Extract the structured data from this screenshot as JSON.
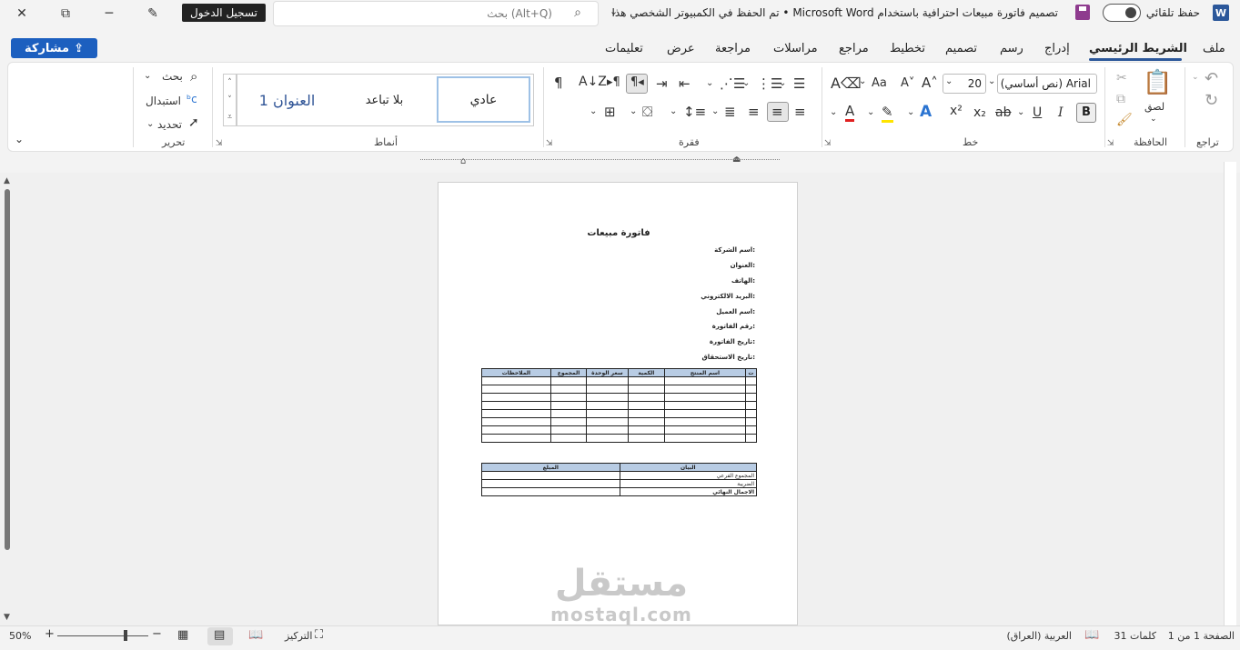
{
  "titlebar": {
    "close": "✕",
    "restore": "⧉",
    "minimize": "─",
    "pen": "✎",
    "signin": "تسجيل الدخول",
    "search_placeholder": "بحث (Alt+Q)",
    "doc_title": "تصميم فاتورة مبيعات احترافية باستخدام Microsoft Word • تم الحفظ في الكمبيوتر الشخصي هذا",
    "autosave_label": "حفظ تلقائي",
    "word_logo": "W"
  },
  "menu": {
    "share": "مشاركة",
    "items": [
      "ملف",
      "الشريط الرئيسي",
      "إدراج",
      "رسم",
      "تصميم",
      "تخطيط",
      "مراجع",
      "مراسلات",
      "مراجعة",
      "عرض",
      "تعليمات"
    ]
  },
  "ribbon": {
    "groups": {
      "undo": "تراجع",
      "clipboard": "الحافظة",
      "font": "خط",
      "paragraph": "فقرة",
      "styles": "أنماط",
      "editing": "تحرير"
    },
    "paste": "لصق",
    "font_name": "Arial (نص أساسي)",
    "font_size": "20",
    "styles": [
      "عادي",
      "بلا تباعد",
      "العنوان 1"
    ],
    "editing": [
      "بحث",
      "استبدال",
      "تحديد"
    ]
  },
  "document": {
    "title": "فاتورة مبيعات",
    "fields": [
      "اسم الشركة:",
      "العنوان:",
      "الهاتف:",
      "البريد الالكتروني:",
      "اسم العميل:",
      "رقم الفاتورة:",
      "تاريخ الفاتورة:",
      "تاريخ الاستحقاق:"
    ],
    "items_table": {
      "headers": [
        "ت",
        "اسم المنتج",
        "الكمية",
        "سعر الوحدة",
        "المجموع",
        "الملاحظات"
      ],
      "empty_rows": 8
    },
    "summary_table": {
      "headers": [
        "البيان",
        "المبلغ"
      ],
      "rows": [
        "المجموع الفرعي",
        "الضريبة",
        "الاجمال النهائي"
      ]
    }
  },
  "watermark": {
    "ar": "مستقل",
    "en": "mostaql.com"
  },
  "status": {
    "page": "الصفحة 1 من 1",
    "words": "31 كلمات",
    "language": "العربية (العراق)",
    "focus": "التركيز",
    "zoom": "50%"
  }
}
